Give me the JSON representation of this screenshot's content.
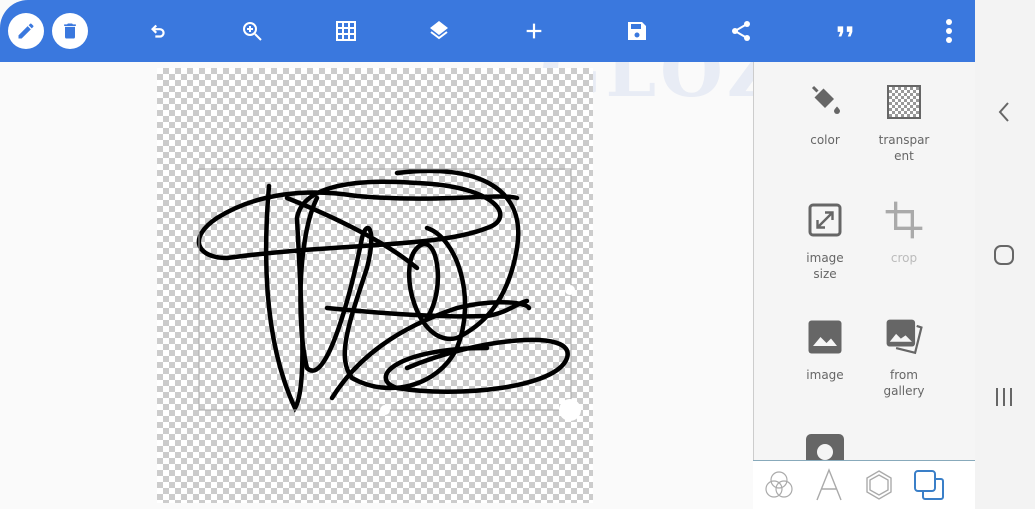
{
  "watermark": "GLOZARIA",
  "toolbar": {
    "color": "#3a78de",
    "buttons": [
      "pencil-icon",
      "trash-icon",
      "undo-icon",
      "zoom-in-icon",
      "grid-icon",
      "layers-icon",
      "add-icon",
      "save-icon",
      "share-icon",
      "quote-icon",
      "more-vert-icon"
    ]
  },
  "panel": {
    "tools": [
      {
        "label": "color",
        "icon": "paint-bucket-icon"
      },
      {
        "label": "transpar\nent",
        "icon": "transparent-icon"
      },
      {
        "label": "image\nsize",
        "icon": "resize-icon"
      },
      {
        "label": "crop",
        "icon": "crop-icon",
        "disabled": true
      },
      {
        "label": "image",
        "icon": "image-icon"
      },
      {
        "label": "from\ngallery",
        "icon": "gallery-icon"
      }
    ],
    "tabs": [
      "blend-icon",
      "text-icon",
      "shape-icon",
      "layers-copy-icon"
    ],
    "active_tab": 3
  },
  "nav": [
    "back-icon",
    "home-icon",
    "recents-icon"
  ]
}
